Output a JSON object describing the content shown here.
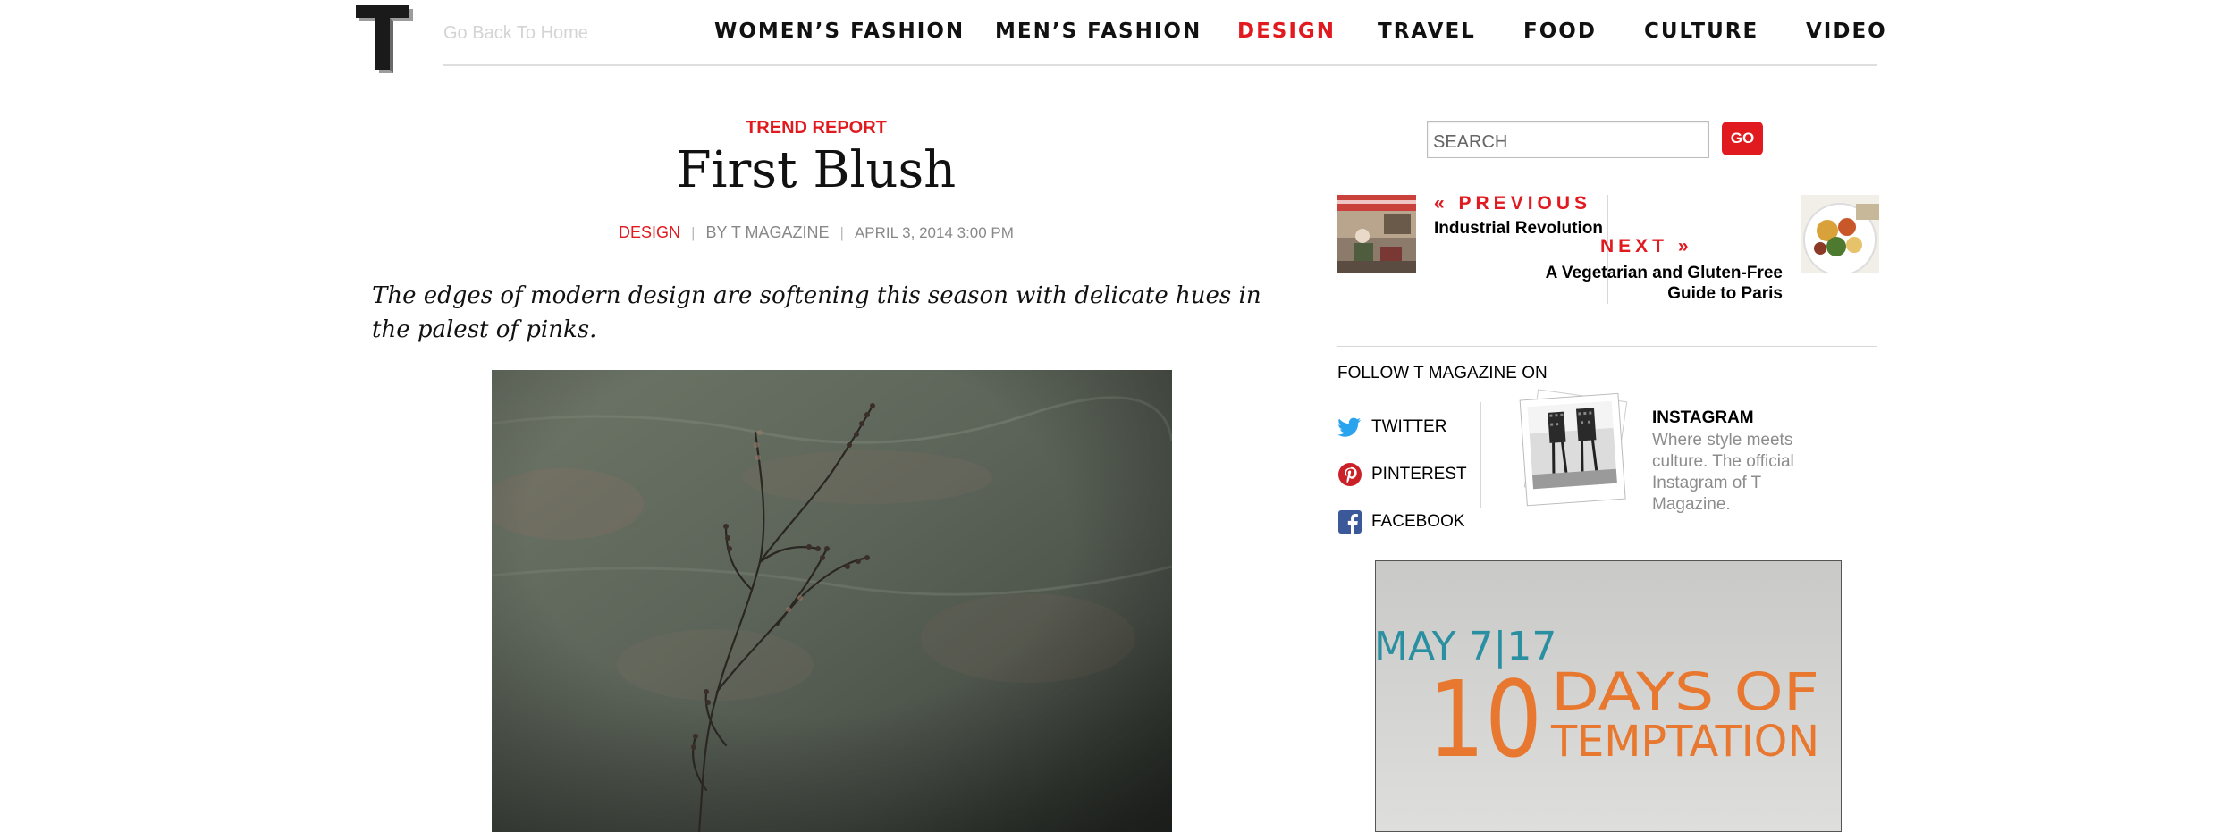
{
  "header": {
    "logo_letter": "T",
    "back_link": "Go Back To Home",
    "nav": [
      {
        "label": "WOMEN’S FASHION",
        "active": false
      },
      {
        "label": "MEN’S FASHION",
        "active": false
      },
      {
        "label": "DESIGN",
        "active": true
      },
      {
        "label": "TRAVEL",
        "active": false
      },
      {
        "label": "FOOD",
        "active": false
      },
      {
        "label": "CULTURE",
        "active": false
      },
      {
        "label": "VIDEO",
        "active": false
      }
    ]
  },
  "article": {
    "kicker": "TREND REPORT",
    "headline": "First Blush",
    "section": "DESIGN",
    "author": "BY T MAGAZINE",
    "date": "APRIL 3, 2014 3:00 PM",
    "dek": "The edges of modern design are softening this season with delicate hues in the palest of pinks."
  },
  "sidebar": {
    "search_placeholder": "SEARCH",
    "go_label": "GO",
    "prev_label": "« PREVIOUS",
    "prev_title": "Industrial Revolution",
    "next_label": "NEXT »",
    "next_title": "A Vegetarian and Gluten-Free Guide to Paris",
    "follow_heading": "FOLLOW T MAGAZINE ON",
    "social": [
      {
        "label": "TWITTER",
        "icon": "twitter-icon"
      },
      {
        "label": "PINTEREST",
        "icon": "pinterest-icon"
      },
      {
        "label": "FACEBOOK",
        "icon": "facebook-icon"
      }
    ],
    "instagram_title": "INSTAGRAM",
    "instagram_desc": "Where style meets culture. The official Instagram of T Magazine.",
    "ad": {
      "date_line": "MAY 7|17",
      "number": "10",
      "line1": "DAYS OF",
      "line2": "TEMPTATION"
    }
  },
  "colors": {
    "accent_red": "#e01a1f",
    "ad_teal": "#2a8fa0",
    "ad_orange": "#e8782f"
  }
}
